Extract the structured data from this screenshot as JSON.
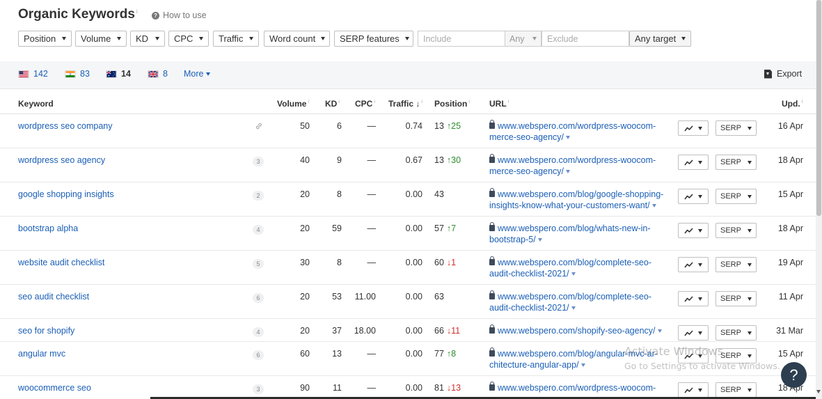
{
  "header": {
    "title": "Organic Keywords",
    "title_info": "i",
    "how_to_use": "How to use",
    "help_icon_glyph": "?"
  },
  "filters": {
    "position": "Position",
    "volume": "Volume",
    "kd": "KD",
    "cpc": "CPC",
    "traffic": "Traffic",
    "word_count": "Word count",
    "serp_features": "SERP features",
    "include_placeholder": "Include",
    "include_mode": "Any",
    "exclude_placeholder": "Exclude",
    "target": "Any target"
  },
  "countries": [
    {
      "code": "us",
      "count": "142",
      "active": false
    },
    {
      "code": "in",
      "count": "83",
      "active": false
    },
    {
      "code": "au",
      "count": "14",
      "active": true
    },
    {
      "code": "gb",
      "count": "8",
      "active": false
    }
  ],
  "more_label": "More",
  "export_label": "Export",
  "table": {
    "headers": {
      "keyword": "Keyword",
      "volume": "Volume",
      "kd": "KD",
      "cpc": "CPC",
      "traffic": "Traffic",
      "position": "Position",
      "url": "URL",
      "updated": "Upd."
    },
    "info_mark": "i",
    "sort_arrow": "↓",
    "serp_label": "SERP",
    "rows": [
      {
        "keyword": "wordpress seo company",
        "serp_count": "",
        "volume": "50",
        "kd": "6",
        "cpc": "—",
        "traffic": "0.74",
        "position": "13",
        "change": "↑25",
        "change_dir": "up",
        "url": "www.webspero.com/wordpress-woocom-merce-seo-agency/",
        "updated": "16 Apr"
      },
      {
        "keyword": "wordpress seo agency",
        "serp_count": "3",
        "volume": "40",
        "kd": "9",
        "cpc": "—",
        "traffic": "0.67",
        "position": "13",
        "change": "↑30",
        "change_dir": "up",
        "url": "www.webspero.com/wordpress-woocom-merce-seo-agency/",
        "updated": "18 Apr"
      },
      {
        "keyword": "google shopping insights",
        "serp_count": "2",
        "volume": "20",
        "kd": "8",
        "cpc": "—",
        "traffic": "0.00",
        "position": "43",
        "change": "",
        "change_dir": "",
        "url": "www.webspero.com/blog/google-shopping-insights-know-what-your-customers-want/",
        "updated": "15 Apr"
      },
      {
        "keyword": "bootstrap alpha",
        "serp_count": "4",
        "volume": "20",
        "kd": "59",
        "cpc": "—",
        "traffic": "0.00",
        "position": "57",
        "change": "↑7",
        "change_dir": "up",
        "url": "www.webspero.com/blog/whats-new-in-bootstrap-5/",
        "updated": "18 Apr"
      },
      {
        "keyword": "website audit checklist",
        "serp_count": "5",
        "volume": "30",
        "kd": "8",
        "cpc": "—",
        "traffic": "0.00",
        "position": "60",
        "change": "↓1",
        "change_dir": "down",
        "url": "www.webspero.com/blog/complete-seo-audit-checklist-2021/",
        "updated": "19 Apr"
      },
      {
        "keyword": "seo audit checklist",
        "serp_count": "6",
        "volume": "20",
        "kd": "53",
        "cpc": "11.00",
        "traffic": "0.00",
        "position": "63",
        "change": "",
        "change_dir": "",
        "url": "www.webspero.com/blog/complete-seo-audit-checklist-2021/",
        "updated": "11 Apr"
      },
      {
        "keyword": "seo for shopify",
        "serp_count": "4",
        "volume": "20",
        "kd": "37",
        "cpc": "18.00",
        "traffic": "0.00",
        "position": "66",
        "change": "↓11",
        "change_dir": "down",
        "url": "www.webspero.com/shopify-seo-agency/",
        "updated": "31 Mar"
      },
      {
        "keyword": "angular mvc",
        "serp_count": "6",
        "volume": "60",
        "kd": "13",
        "cpc": "—",
        "traffic": "0.00",
        "position": "77",
        "change": "↑8",
        "change_dir": "up",
        "url": "www.webspero.com/blog/angular-mvc-ar-chitecture-angular-app/",
        "updated": "15 Apr"
      },
      {
        "keyword": "woocommerce seo",
        "serp_count": "3",
        "volume": "90",
        "kd": "11",
        "cpc": "—",
        "traffic": "0.00",
        "position": "81",
        "change": "↓13",
        "change_dir": "down",
        "url": "www.webspero.com/wordpress-woocom-",
        "updated": "18 Apr"
      }
    ]
  },
  "watermark": {
    "line1": "Activate Windows",
    "line2": "Go to Settings to activate Windows."
  },
  "colors": {
    "link": "#1b5fb6",
    "up": "#2e8b2e",
    "down": "#d0312d",
    "country_bar": "#f5f6f7"
  }
}
